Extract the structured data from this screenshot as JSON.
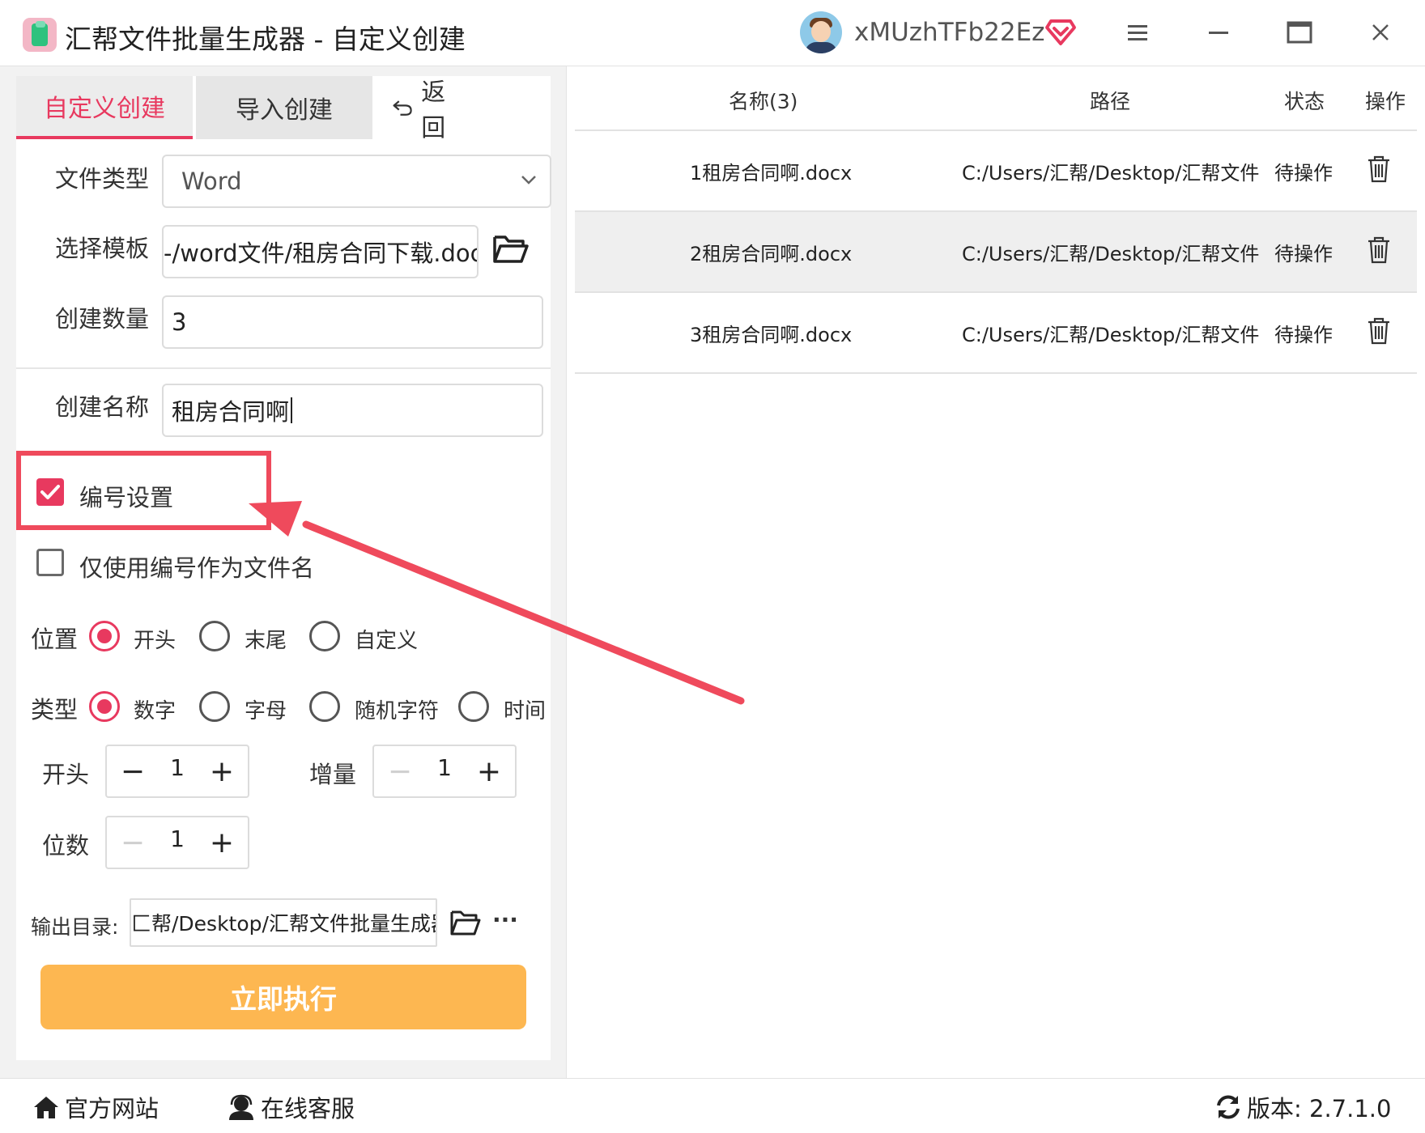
{
  "app": {
    "title": "汇帮文件批量生成器 - 自定义创建",
    "username": "xMUzhTFb22Ez"
  },
  "tabs": {
    "custom": "自定义创建",
    "import": "导入创建",
    "back": "返 回"
  },
  "form": {
    "file_type_label": "文件类型",
    "file_type_value": "Word",
    "template_label": "选择模板",
    "template_value": "-/word文件/租房合同下载.doc",
    "count_label": "创建数量",
    "count_value": "3",
    "name_label": "创建名称",
    "name_value": "租房合同啊"
  },
  "numbering": {
    "enable_label": "编号设置",
    "enable_checked": true,
    "only_number_label": "仅使用编号作为文件名",
    "only_number_checked": false,
    "position_label": "位置",
    "position_options": [
      "开头",
      "末尾",
      "自定义"
    ],
    "position_selected": "开头",
    "type_label": "类型",
    "type_options": [
      "数字",
      "字母",
      "随机字符",
      "时间"
    ],
    "type_selected": "数字",
    "start_label": "开头",
    "start_value": "1",
    "increment_label": "增量",
    "increment_value": "1",
    "digits_label": "位数",
    "digits_value": "1"
  },
  "output": {
    "label": "输出目录:",
    "path": "匚帮/Desktop/汇帮文件批量生成器",
    "more": "···"
  },
  "run_button": "立即执行",
  "table": {
    "headers": {
      "name": "名称(3)",
      "path": "路径",
      "status": "状态",
      "action": "操作"
    },
    "rows": [
      {
        "name": "1租房合同啊.docx",
        "path": "C:/Users/汇帮/Desktop/汇帮文件",
        "status": "待操作"
      },
      {
        "name": "2租房合同啊.docx",
        "path": "C:/Users/汇帮/Desktop/汇帮文件",
        "status": "待操作"
      },
      {
        "name": "3租房合同啊.docx",
        "path": "C:/Users/汇帮/Desktop/汇帮文件",
        "status": "待操作"
      }
    ]
  },
  "footer": {
    "website": "官方网站",
    "support": "在线客服",
    "version": "版本: 2.7.1.0"
  },
  "colors": {
    "accent": "#e8395f",
    "run_button": "#fdb751",
    "annotation": "#ef4a5c"
  },
  "icons": [
    "app-icon",
    "avatar",
    "vip-diamond-icon",
    "menu-icon",
    "minimize-icon",
    "maximize-icon",
    "close-icon",
    "back-arrow-icon",
    "chevron-down-icon",
    "folder-open-icon",
    "trash-icon",
    "home-icon",
    "support-icon",
    "refresh-icon"
  ]
}
